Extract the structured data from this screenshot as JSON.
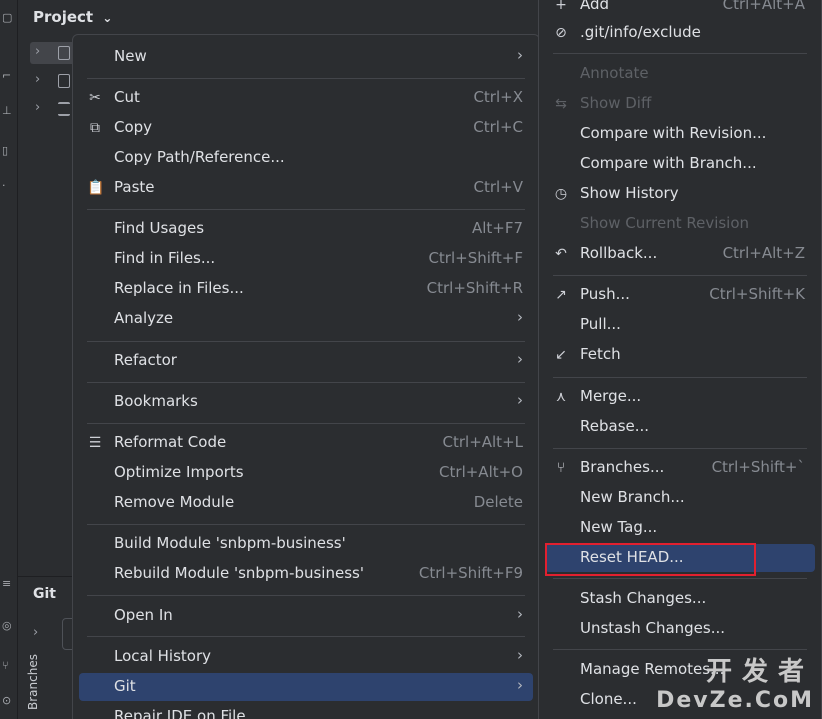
{
  "ide": {
    "project_title": "Project",
    "git_panel_title": "Git",
    "branches_tab": "Branches"
  },
  "menu1": [
    {
      "label": "New",
      "shortcut": "",
      "submenu": true,
      "icon": ""
    },
    {
      "label": "Cut",
      "shortcut": "Ctrl+X",
      "submenu": false,
      "icon": "scissors-icon"
    },
    {
      "label": "Copy",
      "shortcut": "Ctrl+C",
      "submenu": false,
      "icon": "copy-icon"
    },
    {
      "label": "Copy Path/Reference...",
      "shortcut": "",
      "submenu": false,
      "icon": ""
    },
    {
      "label": "Paste",
      "shortcut": "Ctrl+V",
      "submenu": false,
      "icon": "paste-icon"
    },
    {
      "label": "Find Usages",
      "shortcut": "Alt+F7",
      "submenu": false,
      "icon": ""
    },
    {
      "label": "Find in Files...",
      "shortcut": "Ctrl+Shift+F",
      "submenu": false,
      "icon": ""
    },
    {
      "label": "Replace in Files...",
      "shortcut": "Ctrl+Shift+R",
      "submenu": false,
      "icon": ""
    },
    {
      "label": "Analyze",
      "shortcut": "",
      "submenu": true,
      "icon": ""
    },
    {
      "label": "Refactor",
      "shortcut": "",
      "submenu": true,
      "icon": ""
    },
    {
      "label": "Bookmarks",
      "shortcut": "",
      "submenu": true,
      "icon": ""
    },
    {
      "label": "Reformat Code",
      "shortcut": "Ctrl+Alt+L",
      "submenu": false,
      "icon": "reformat-icon"
    },
    {
      "label": "Optimize Imports",
      "shortcut": "Ctrl+Alt+O",
      "submenu": false,
      "icon": ""
    },
    {
      "label": "Remove Module",
      "shortcut": "Delete",
      "submenu": false,
      "icon": ""
    },
    {
      "label": "Build Module 'snbpm-business'",
      "shortcut": "",
      "submenu": false,
      "icon": ""
    },
    {
      "label": "Rebuild Module 'snbpm-business'",
      "shortcut": "Ctrl+Shift+F9",
      "submenu": false,
      "icon": ""
    },
    {
      "label": "Open In",
      "shortcut": "",
      "submenu": true,
      "icon": ""
    },
    {
      "label": "Local History",
      "shortcut": "",
      "submenu": true,
      "icon": ""
    },
    {
      "label": "Git",
      "shortcut": "",
      "submenu": true,
      "icon": "",
      "highlighted": true
    },
    {
      "label": "Repair IDE on File",
      "shortcut": "",
      "submenu": false,
      "icon": ""
    }
  ],
  "menu2": [
    {
      "label": "Add",
      "shortcut": "Ctrl+Alt+A",
      "icon": "plus-icon",
      "disabled": false
    },
    {
      "label": ".git/info/exclude",
      "shortcut": "",
      "icon": "ignore-icon",
      "disabled": false
    },
    {
      "label": "Annotate",
      "shortcut": "",
      "icon": "",
      "disabled": true
    },
    {
      "label": "Show Diff",
      "shortcut": "",
      "icon": "diff-icon",
      "disabled": true
    },
    {
      "label": "Compare with Revision...",
      "shortcut": "",
      "icon": "",
      "disabled": false
    },
    {
      "label": "Compare with Branch...",
      "shortcut": "",
      "icon": "",
      "disabled": false
    },
    {
      "label": "Show History",
      "shortcut": "",
      "icon": "history-icon",
      "disabled": false
    },
    {
      "label": "Show Current Revision",
      "shortcut": "",
      "icon": "",
      "disabled": true
    },
    {
      "label": "Rollback...",
      "shortcut": "Ctrl+Alt+Z",
      "icon": "rollback-icon",
      "disabled": false
    },
    {
      "label": "Push...",
      "shortcut": "Ctrl+Shift+K",
      "icon": "push-icon",
      "disabled": false
    },
    {
      "label": "Pull...",
      "shortcut": "",
      "icon": "",
      "disabled": false
    },
    {
      "label": "Fetch",
      "shortcut": "",
      "icon": "fetch-icon",
      "disabled": false
    },
    {
      "label": "Merge...",
      "shortcut": "",
      "icon": "merge-icon",
      "disabled": false
    },
    {
      "label": "Rebase...",
      "shortcut": "",
      "icon": "",
      "disabled": false
    },
    {
      "label": "Branches...",
      "shortcut": "Ctrl+Shift+`",
      "icon": "branch-icon",
      "disabled": false
    },
    {
      "label": "New Branch...",
      "shortcut": "",
      "icon": "",
      "disabled": false
    },
    {
      "label": "New Tag...",
      "shortcut": "",
      "icon": "",
      "disabled": false
    },
    {
      "label": "Reset HEAD...",
      "shortcut": "",
      "icon": "",
      "disabled": false,
      "highlighted": true
    },
    {
      "label": "Stash Changes...",
      "shortcut": "",
      "icon": "",
      "disabled": false
    },
    {
      "label": "Unstash Changes...",
      "shortcut": "",
      "icon": "",
      "disabled": false
    },
    {
      "label": "Manage Remotes...",
      "shortcut": "",
      "icon": "",
      "disabled": false
    },
    {
      "label": "Clone...",
      "shortcut": "",
      "icon": "",
      "disabled": false
    }
  ],
  "watermark": {
    "cn": "开发者",
    "en": "DevZe.CoM"
  },
  "colors": {
    "highlight": "#2e436e",
    "annotation_box": "#e2202f"
  }
}
